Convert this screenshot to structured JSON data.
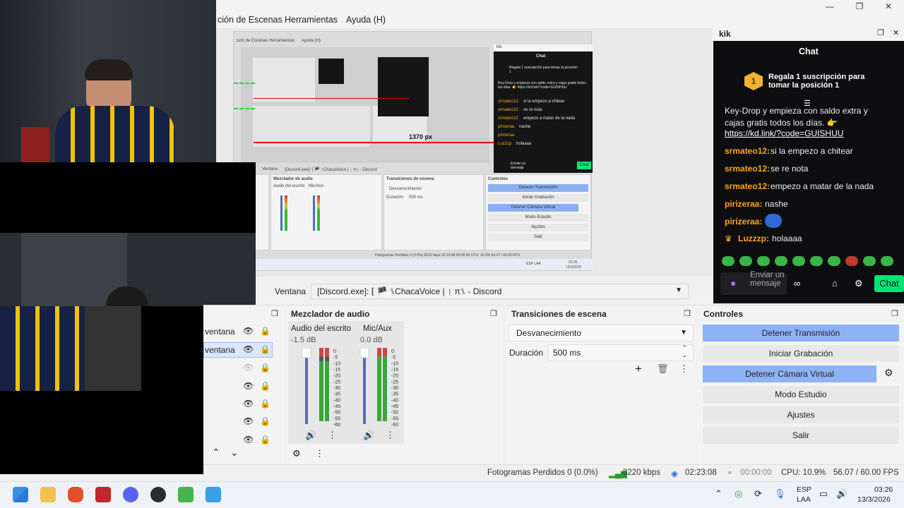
{
  "menu": {
    "scenes": "ción de Escenas",
    "tools": "Herramientas",
    "help": "Ayuda (H)"
  },
  "preview": {
    "nested_menu": [
      "ción de Escenas",
      "Herramientas",
      "Ayuda (H)"
    ],
    "measure_label": "1370 px",
    "nested_source_label": "Ventana",
    "nested_source_value": "[Discord.exe]: ⁅ 🏴 ⑊ChacaVoice | ⁅ π⑊ - Discord",
    "nested_mixer_title": "Mezclador de audio",
    "nested_mixer_ch1": "Audio del escrito",
    "nested_mixer_ch2": "Mic/Aux",
    "nested_transitions_title": "Transiciones de escena",
    "nested_fade": "Desvanecimiento",
    "nested_duration": "Duración",
    "nested_ms": "500 ms",
    "nested_controls_title": "Controles",
    "nested_buttons": [
      "Detener Transmisión",
      "Iniciar Grabación",
      "Detener Cámara Virtual",
      "Modo Estudio",
      "Ajustes",
      "Salir"
    ],
    "nested_status": "Fotogramas Perdidos 0 (0.0%)   8220 kbps   02:23:08   00:00:00   CPU: 10.9%   56.07 / 60.00 FPS",
    "nested_clock": "03:26",
    "nested_date": "13/3/2026",
    "nested_lang": "ESP LAA",
    "nested_chat_header": "kik",
    "nested_chat_title": "Chat",
    "nested_chat_gift": "Regala 1 suscripción para tomar la posición 1",
    "nested_chat_lines": [
      {
        "user": "",
        "text": "Key-Drop y empieza con saldo extra y cajas gratis todos los días. 👉 https://kd.link/?code=GUISHUU"
      },
      {
        "user": "srmateo12:",
        "text": "si la empezo a chitear"
      },
      {
        "user": "srmateo12:",
        "text": "se re nota"
      },
      {
        "user": "srmateo12:",
        "text": "empezo a matar de la nada"
      },
      {
        "user": "pirizeraa:",
        "text": "nashe"
      },
      {
        "user": "pirizeraa:",
        "text": ""
      },
      {
        "user": "Luzzzp:",
        "text": "holaaaa"
      }
    ],
    "nested_chat_send": "Enviar un mensaje",
    "nested_chat_button": "Chat"
  },
  "source_bar": {
    "label": "Ventana",
    "value": "[Discord.exe]: ⁅ 🏴 ⑊ChacaVoice | ⁅ π⑊ - Discord"
  },
  "sources": {
    "items": [
      {
        "label": "ventana"
      },
      {
        "label": "ventana"
      },
      {
        "label": ""
      },
      {
        "label": ""
      },
      {
        "label": ""
      },
      {
        "label": ""
      },
      {
        "label": ""
      }
    ]
  },
  "mixer": {
    "title": "Mezclador de audio",
    "channels": [
      {
        "name": "Audio del escrito",
        "db": "-1.5 dB",
        "level": 0.82
      },
      {
        "name": "Mic/Aux",
        "db": "0.0 dB",
        "level": 0.92
      }
    ],
    "scale": [
      "0",
      "-5",
      "-10",
      "-15",
      "-20",
      "-25",
      "-30",
      "-35",
      "-40",
      "-45",
      "-50",
      "-55",
      "-60"
    ]
  },
  "transitions": {
    "title": "Transiciones de escena",
    "selected": "Desvanecimiento",
    "duration_label": "Duración",
    "duration_value": "500 ms"
  },
  "controls": {
    "title": "Controles",
    "buttons": [
      "Detener Transmisión",
      "Iniciar Grabación",
      "Detener Cámara Virtual",
      "Modo Estudio",
      "Ajustes",
      "Salir"
    ]
  },
  "chat": {
    "window_title": "kik",
    "title": "Chat",
    "gift_text": "Regala 1 suscripción para tomar la posición 1",
    "gift_number": "1",
    "promo_line1": "Key-Drop y empieza con saldo extra y",
    "promo_line2": "cajas gratis todos los días. 👉",
    "promo_link": "https://kd.link/?code=GUISHUU",
    "messages": [
      {
        "user": "srmateo12:",
        "text": "si la empezo a chitear"
      },
      {
        "user": "srmateo12:",
        "text": "se re nota"
      },
      {
        "user": "srmateo12:",
        "text": "empezo a matar de la nada"
      },
      {
        "user": "pirizeraa:",
        "text": "nashe"
      },
      {
        "user": "pirizeraa:",
        "text": ""
      },
      {
        "user": "Luzzzp:",
        "text": "holaaaa"
      }
    ],
    "send_placeholder": "Enviar un mensaje",
    "send_button": "Chat"
  },
  "status": {
    "dropped": "Fotogramas Perdidos 0 (0.0%)",
    "bitrate": "8220 kbps",
    "stream_time": "02:23:08",
    "rec_time": "00:00:00",
    "cpu": "CPU: 10.9%",
    "fps": "56.07 / 60.00 FPS"
  },
  "taskbar": {
    "lang_line1": "ESP",
    "lang_line2": "LAA",
    "time": "03:26",
    "date": "13/3/2026",
    "apps": [
      "start-icon",
      "file-explorer-icon",
      "brave-icon",
      "voicemeeter-icon",
      "discord-icon",
      "obs-icon",
      "android-icon",
      "photos-icon"
    ]
  },
  "colors": {
    "accent_blue": "#8db3f6",
    "chat_bg": "#0e0e10",
    "username": "#f5a623",
    "send_button": "#00e676"
  }
}
